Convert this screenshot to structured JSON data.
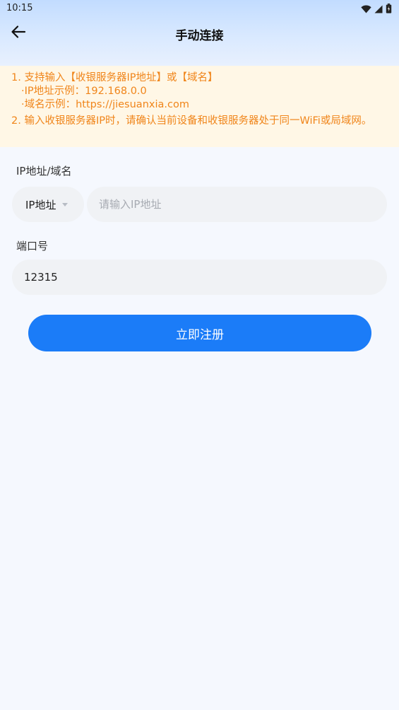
{
  "status_bar": {
    "time": "10:15",
    "icons": [
      "wifi-icon",
      "signal-icon",
      "battery-icon"
    ]
  },
  "header": {
    "title": "手动连接",
    "back_icon": "arrow-left-icon"
  },
  "notice": {
    "item1": "1. 支持输入【收银服务器IP地址】或【域名】",
    "item1_example_ip": "·IP地址示例：192.168.0.0",
    "item1_example_domain": "·域名示例：https://jiesuanxia.com",
    "item2": "2. 输入收银服务器IP时，请确认当前设备和收银服务器处于同一WiFi或局域网。"
  },
  "form": {
    "address_label": "IP地址/域名",
    "address_type": "IP地址",
    "address_placeholder": "请输入IP地址",
    "address_value": "",
    "port_label": "端口号",
    "port_value": "12315"
  },
  "actions": {
    "submit_label": "立即注册"
  },
  "colors": {
    "accent": "#1b7cf8",
    "notice_text": "#f0851a",
    "notice_bg": "#fff7e6",
    "page_bg": "#f5f8fe"
  }
}
